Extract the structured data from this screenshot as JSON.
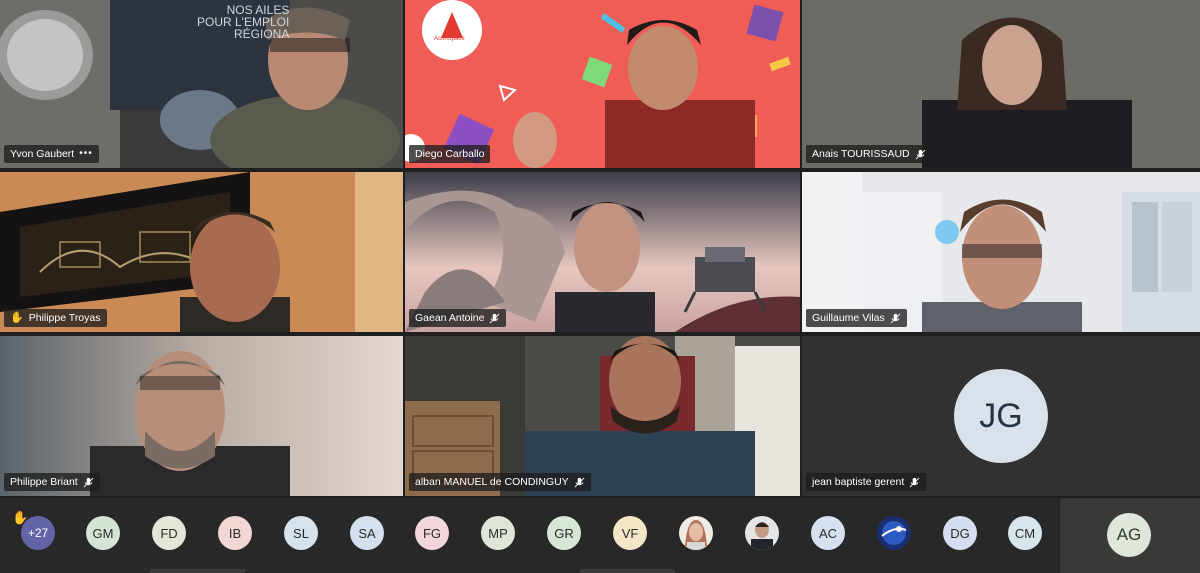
{
  "participants": [
    {
      "name": "Yvon Gaubert",
      "indicator": "•••"
    },
    {
      "name": "Diego Carballo",
      "indicator": ""
    },
    {
      "name": "Anais TOURISSAUD",
      "indicator": "mic"
    },
    {
      "name": "Philippe Troyas",
      "indicator": "hand"
    },
    {
      "name": "Gaean Antoine",
      "indicator": "mic"
    },
    {
      "name": "Guillaume Vilas",
      "indicator": "mic"
    },
    {
      "name": "Philippe Briant",
      "indicator": "mic"
    },
    {
      "name": "alban MANUEL de CONDINGUY",
      "indicator": "mic"
    },
    {
      "name": "jean baptiste gerent",
      "indicator": "mic",
      "initials": "JG"
    }
  ],
  "background_texts": {
    "poster_line1": "NOS AILES",
    "poster_line2": "POUR L'EMPLOI",
    "poster_line3": "RÉGIONA",
    "actinspace_logo": "ActInSpace"
  },
  "tray": {
    "overflow_count": "+27",
    "hand_icon": "✋",
    "avatars": [
      {
        "initials": "GM",
        "color": "#d4e4d4"
      },
      {
        "initials": "FD",
        "color": "#e4e7d8"
      },
      {
        "initials": "IB",
        "color": "#f2d6d4"
      },
      {
        "initials": "SL",
        "color": "#d7e3ec"
      },
      {
        "initials": "SA",
        "color": "#d5e0ef"
      },
      {
        "initials": "FG",
        "color": "#f3d6dc"
      },
      {
        "initials": "MP",
        "color": "#dfe6d8"
      },
      {
        "initials": "GR",
        "color": "#d6e6d7"
      },
      {
        "initials": "VF",
        "color": "#f4e7c8"
      },
      {
        "initials": "",
        "color": "#caa59a"
      },
      {
        "initials": "",
        "color": "#4a5466"
      },
      {
        "initials": "AC",
        "color": "#d6e1ef"
      },
      {
        "initials": "",
        "color": "#1f3f8f"
      },
      {
        "initials": "DG",
        "color": "#d5def0"
      },
      {
        "initials": "CM",
        "color": "#d7e5ec"
      }
    ],
    "active_speaker": {
      "initials": "AG"
    }
  }
}
